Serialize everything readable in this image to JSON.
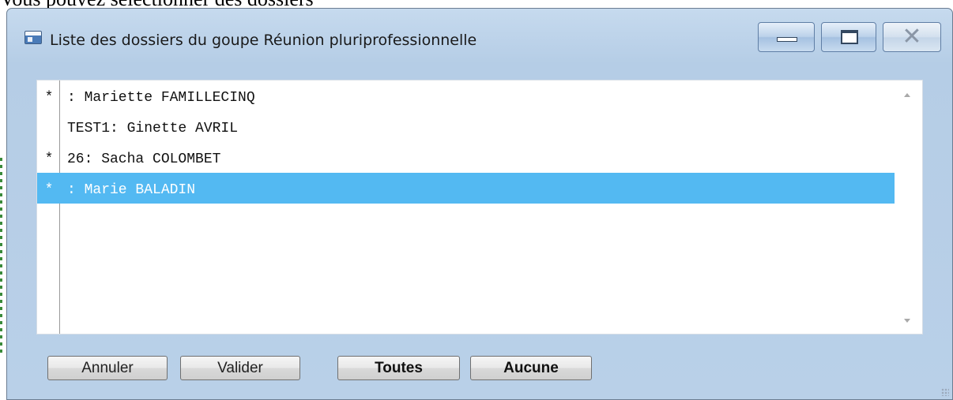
{
  "background_caption": "Vous pouvez sélectionner des dossiers",
  "window": {
    "title": "Liste des dossiers du goupe Réunion pluriprofessionnelle",
    "icon": "app-window-icon",
    "controls": {
      "minimize": "minimize-icon",
      "maximize": "maximize-icon",
      "close": "close-icon"
    }
  },
  "list": {
    "items": [
      {
        "marker": "*",
        "label": ": Mariette FAMILLECINQ",
        "selected": false
      },
      {
        "marker": "",
        "label": "TEST1: Ginette AVRIL",
        "selected": false
      },
      {
        "marker": "*",
        "label": "26: Sacha COLOMBET",
        "selected": false
      },
      {
        "marker": "*",
        "label": ": Marie BALADIN",
        "selected": true
      }
    ],
    "selection_color": "#53b9f2"
  },
  "buttons": {
    "cancel": "Annuler",
    "validate": "Valider",
    "all": "Toutes",
    "none": "Aucune"
  }
}
